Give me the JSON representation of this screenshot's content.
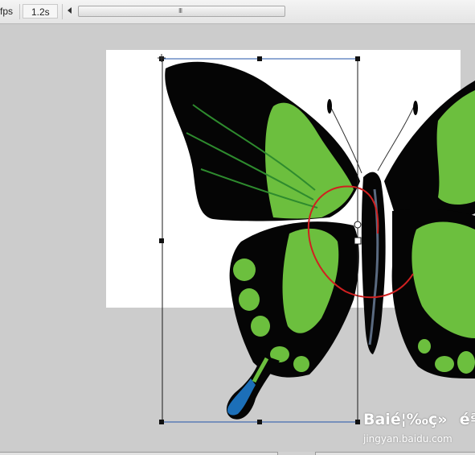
{
  "toolbar": {
    "fps_label": "fps",
    "time_value": "1.2s",
    "scroll_grip": "III"
  },
  "watermark": {
    "logo_text": "Baié¦‰ç»éª",
    "url": "jingyan.baidu.com"
  },
  "colors": {
    "canvas_background": "#cccccc",
    "stage": "#ffffff",
    "wing_black": "#050505",
    "wing_green": "#6cbf3e",
    "vein_dark_green": "#2e8b2e",
    "tail_blue": "#1c6fb8",
    "selection_stroke": "#1a1a1a",
    "motion_path": "#d02020"
  }
}
